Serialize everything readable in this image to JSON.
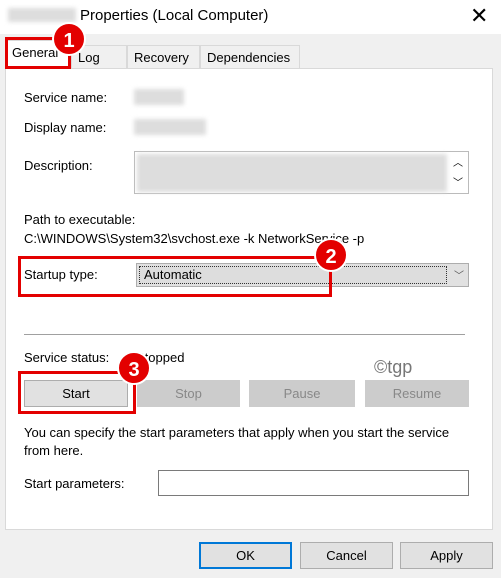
{
  "window": {
    "title": "Properties (Local Computer)",
    "close_icon": "close-icon"
  },
  "tabs": [
    {
      "label": "General"
    },
    {
      "label": "Log On"
    },
    {
      "label": "Recovery"
    },
    {
      "label": "Dependencies"
    }
  ],
  "general": {
    "service_name_label": "Service name:",
    "display_name_label": "Display name:",
    "description_label": "Description:",
    "path_label": "Path to executable:",
    "path_value": "C:\\WINDOWS\\System32\\svchost.exe -k NetworkService -p",
    "startup_type_label": "Startup type:",
    "startup_type_value": "Automatic",
    "service_status_label": "Service status:",
    "service_status_value": "Stopped",
    "buttons": {
      "start": "Start",
      "stop": "Stop",
      "pause": "Pause",
      "resume": "Resume"
    },
    "hint": "You can specify the start parameters that apply when you start the service from here.",
    "start_params_label": "Start parameters:",
    "start_params_value": ""
  },
  "footer": {
    "ok": "OK",
    "cancel": "Cancel",
    "apply": "Apply"
  },
  "annotations": [
    "1",
    "2",
    "3"
  ],
  "watermark": "©tgp",
  "colors": {
    "highlight": "#e30000"
  }
}
